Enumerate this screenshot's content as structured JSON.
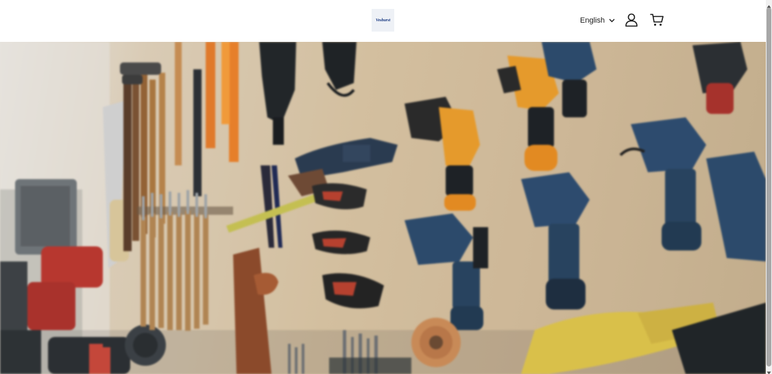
{
  "header": {
    "logo_text": "Vesburst",
    "language": {
      "selected": "English",
      "icon": "chevron-down-icon"
    },
    "account_icon": "user-icon",
    "cart_icon": "shopping-cart-icon"
  },
  "hero": {
    "image": "Workshop wall with power drills, chisels, pliers, hammers and saws hanging on a plywood pegboard"
  },
  "colors": {
    "brand": "#1f3f86",
    "header_bg": "#ffffff",
    "icon_stroke": "#1a1a1a",
    "scrollbar_thumb": "#a7a7a7"
  }
}
